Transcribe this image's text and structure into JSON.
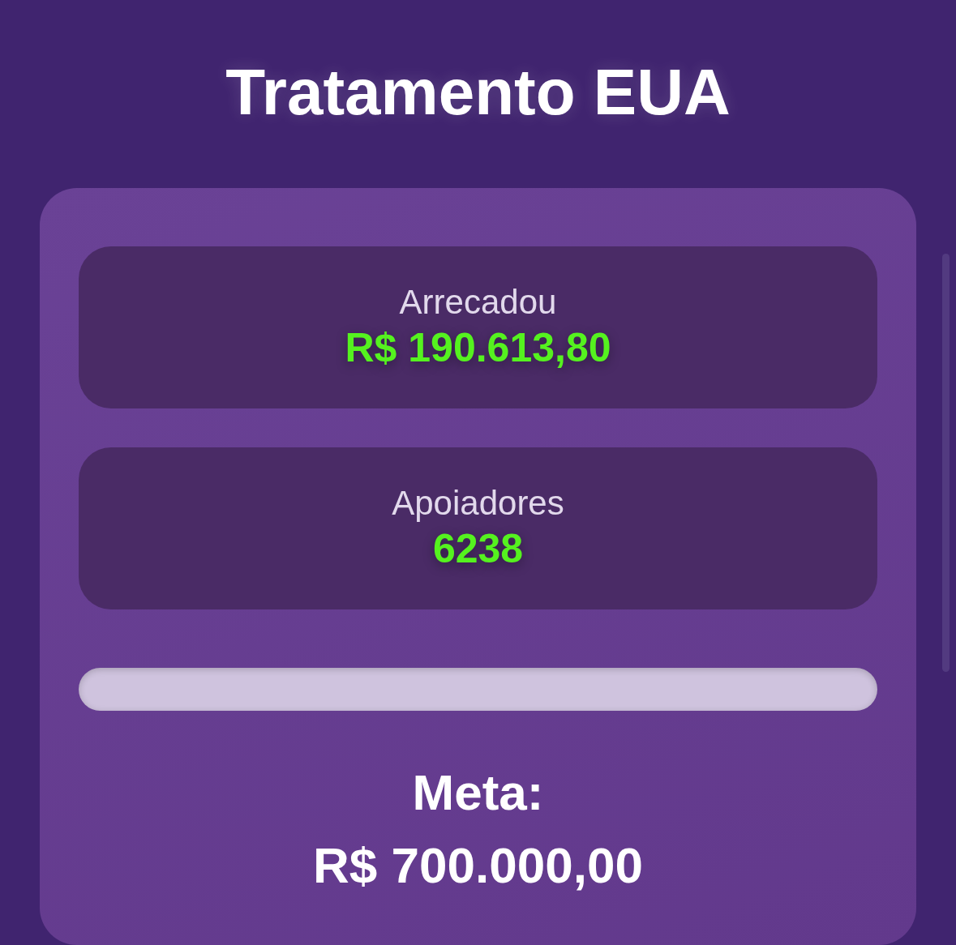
{
  "title": "Tratamento EUA",
  "stats": [
    {
      "label": "Arrecadou",
      "value": "R$ 190.613,80"
    },
    {
      "label": "Apoiadores",
      "value": "6238"
    }
  ],
  "progress": {
    "level": 0
  },
  "goal": {
    "label": "Meta:",
    "value": "R$ 700.000,00"
  }
}
